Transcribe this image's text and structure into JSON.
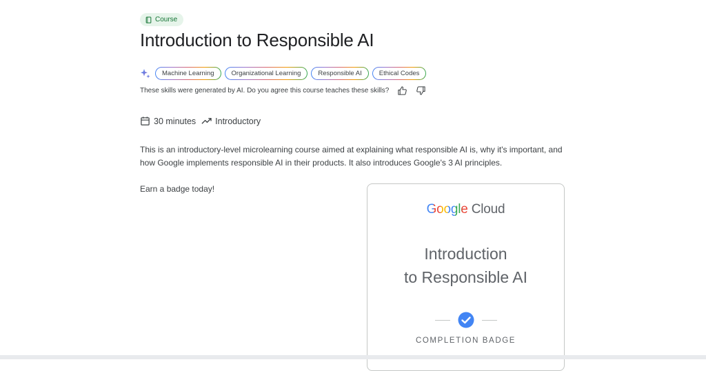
{
  "course_chip": {
    "label": "Course",
    "icon": "book-icon"
  },
  "title": "Introduction to Responsible AI",
  "skills": {
    "icon": "sparkle-icon",
    "items": [
      "Machine Learning",
      "Organizational Learning",
      "Responsible AI",
      "Ethical Codes"
    ],
    "note": "These skills were generated by AI. Do you agree this course teaches these skills?"
  },
  "meta": {
    "duration": "30 minutes",
    "duration_icon": "calendar-icon",
    "level": "Introductory",
    "level_icon": "trending-icon"
  },
  "description": "This is an introductory-level microlearning course aimed at explaining what responsible AI is, why it's important, and how Google implements responsible AI in their products. It also introduces Google's 3 AI principles.",
  "earn_badge": "Earn a badge today!",
  "badge": {
    "brand": {
      "google": "Google",
      "cloud": "Cloud"
    },
    "title_line1": "Introduction",
    "title_line2": "to Responsible AI",
    "completion_label": "COMPLETION BADGE"
  },
  "colors": {
    "google_blue": "#4285f4",
    "google_red": "#ea4335",
    "google_yellow": "#fbbc05",
    "google_green": "#34a853",
    "chip_bg": "#e6f4ea",
    "chip_text": "#137333"
  }
}
